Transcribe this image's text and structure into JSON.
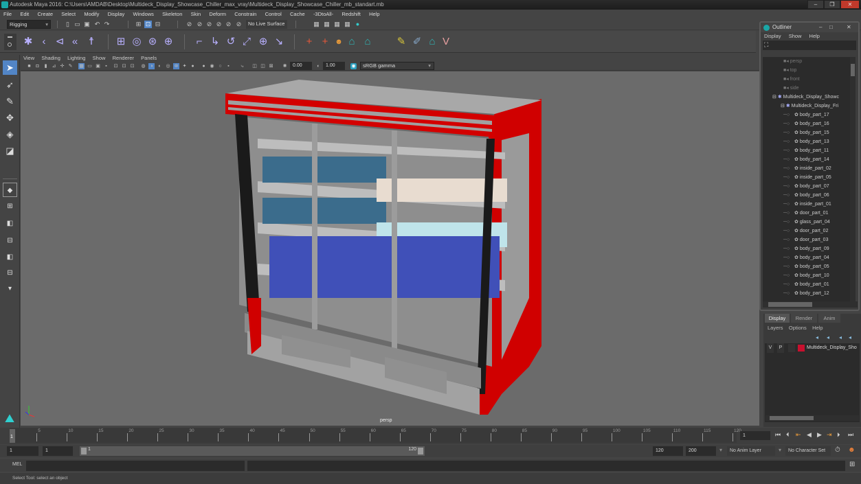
{
  "window": {
    "title": "Autodesk Maya 2016: C:\\Users\\AMDAB\\Desktop\\Multideck_Display_Showcase_Chiller_max_vray\\Multideck_Display_Showcase_Chiller_mb_standart.mb",
    "minimize": "–",
    "restore": "❐",
    "close": "✕"
  },
  "menubar": [
    "File",
    "Edit",
    "Create",
    "Select",
    "Modify",
    "Display",
    "Windows",
    "Skeleton",
    "Skin",
    "Deform",
    "Constrain",
    "Control",
    "Cache",
    "-3DtoAll-",
    "Redshift",
    "Help"
  ],
  "statusline": {
    "mode": "Rigging",
    "live_surface": "No Live Surface"
  },
  "viewport": {
    "menu": [
      "View",
      "Shading",
      "Lighting",
      "Show",
      "Renderer",
      "Panels"
    ],
    "exposure": "0.00",
    "gamma": "1.00",
    "color_space": "sRGB gamma",
    "camera_label": "persp"
  },
  "outliner": {
    "title": "Outliner",
    "menu": [
      "Display",
      "Show",
      "Help"
    ],
    "cameras": [
      "persp",
      "top",
      "front",
      "side"
    ],
    "groups": [
      "Multideck_Display_Showc",
      "Multideck_Display_Fri"
    ],
    "items": [
      "body_part_17",
      "body_part_16",
      "body_part_15",
      "body_part_13",
      "body_part_11",
      "body_part_14",
      "inside_part_02",
      "inside_part_05",
      "body_part_07",
      "body_part_06",
      "inside_part_01",
      "door_part_01",
      "glass_part_04",
      "door_part_02",
      "door_part_03",
      "body_part_09",
      "body_part_04",
      "body_part_05",
      "body_part_10",
      "body_part_01",
      "body_part_12"
    ]
  },
  "layers": {
    "tabs": [
      "Display",
      "Render",
      "Anim"
    ],
    "active_tab": "Display",
    "menu": [
      "Layers",
      "Options",
      "Help"
    ],
    "layer": {
      "v": "V",
      "p": "P",
      "name": "Multideck_Display_Sho",
      "color": "#c8102e"
    }
  },
  "timeline": {
    "ticks": [
      "5",
      "10",
      "15",
      "20",
      "25",
      "30",
      "35",
      "40",
      "45",
      "50",
      "55",
      "60",
      "65",
      "70",
      "75",
      "80",
      "85",
      "90",
      "95",
      "100",
      "105",
      "110",
      "115",
      "120"
    ],
    "current_frame_marker": "1",
    "current_frame": "1"
  },
  "range": {
    "start": "1",
    "start2": "1",
    "slider_start": "1",
    "slider_end": "120",
    "end": "120",
    "end2": "200",
    "anim_layer": "No Anim Layer",
    "character_set": "No Character Set"
  },
  "mel": {
    "label": "MEL"
  },
  "status": {
    "text": "Select Tool: select an object"
  },
  "colors": {
    "accent": "#5285c6",
    "brand_red": "#d60000"
  }
}
